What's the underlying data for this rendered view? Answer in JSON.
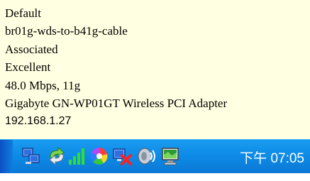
{
  "tooltip": {
    "lines": [
      "Default",
      "br01g-wds-to-b41g-cable",
      "Associated",
      "Excellent",
      "48.0 Mbps, 11g",
      "Gigabyte GN-WP01GT Wireless PCI Adapter",
      "192.168.1.27"
    ]
  },
  "taskbar": {
    "clock": "下午 07:05",
    "icons": [
      "network-computers-icon",
      "connection-arrows-icon",
      "signal-strength-icon",
      "color-wheel-icon",
      "network-error-icon",
      "sound-icon",
      "monitor-icon"
    ]
  },
  "colors": {
    "tooltip_bg": "#ffffe1",
    "taskbar_blue": "#0d8ae6"
  }
}
